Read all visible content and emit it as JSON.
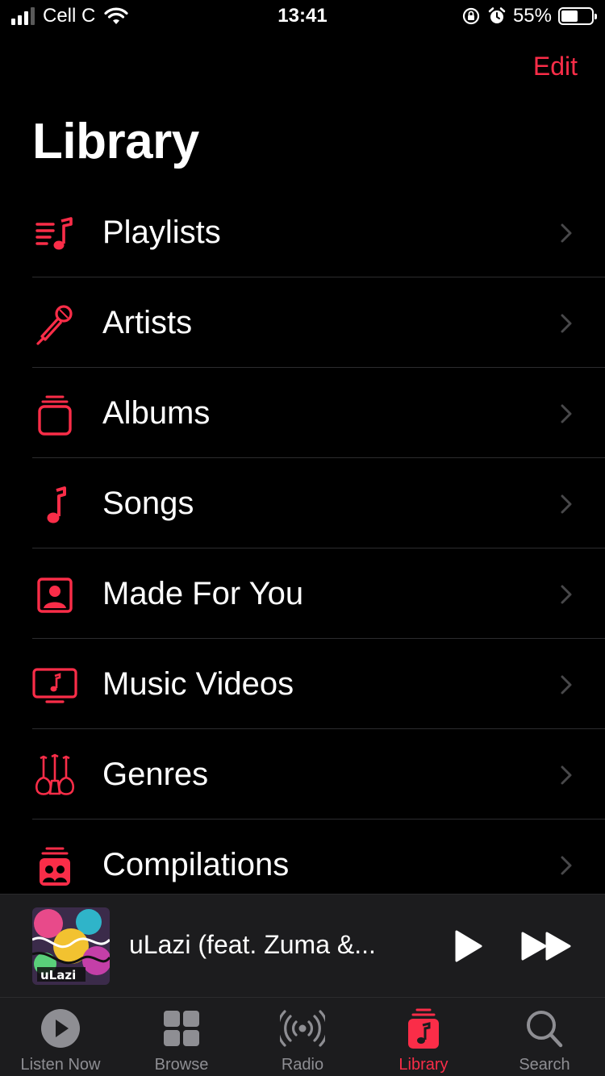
{
  "status_bar": {
    "carrier": "Cell C",
    "time": "13:41",
    "battery_percent": "55%",
    "battery_level": 0.55,
    "icons": [
      "signal-icon",
      "wifi-icon",
      "orientation-lock-icon",
      "alarm-icon",
      "battery-icon"
    ]
  },
  "header": {
    "edit_label": "Edit",
    "title": "Library"
  },
  "library": {
    "items": [
      {
        "label": "Playlists",
        "icon": "playlists-icon"
      },
      {
        "label": "Artists",
        "icon": "microphone-icon"
      },
      {
        "label": "Albums",
        "icon": "album-stack-icon"
      },
      {
        "label": "Songs",
        "icon": "music-note-icon"
      },
      {
        "label": "Made For You",
        "icon": "person-square-icon"
      },
      {
        "label": "Music Videos",
        "icon": "tv-music-icon"
      },
      {
        "label": "Genres",
        "icon": "guitars-icon"
      },
      {
        "label": "Compilations",
        "icon": "compilation-icon"
      }
    ]
  },
  "mini_player": {
    "track_title": "uLazi (feat. Zuma &...",
    "artwork_text": "uLazi"
  },
  "tab_bar": {
    "tabs": [
      {
        "label": "Listen Now",
        "icon": "play-circle-icon",
        "active": false
      },
      {
        "label": "Browse",
        "icon": "grid-icon",
        "active": false
      },
      {
        "label": "Radio",
        "icon": "broadcast-icon",
        "active": false
      },
      {
        "label": "Library",
        "icon": "library-icon",
        "active": true
      },
      {
        "label": "Search",
        "icon": "search-icon",
        "active": false
      }
    ]
  },
  "colors": {
    "accent": "#fa2d48",
    "background": "#000000",
    "inactive": "#8e8e93"
  }
}
